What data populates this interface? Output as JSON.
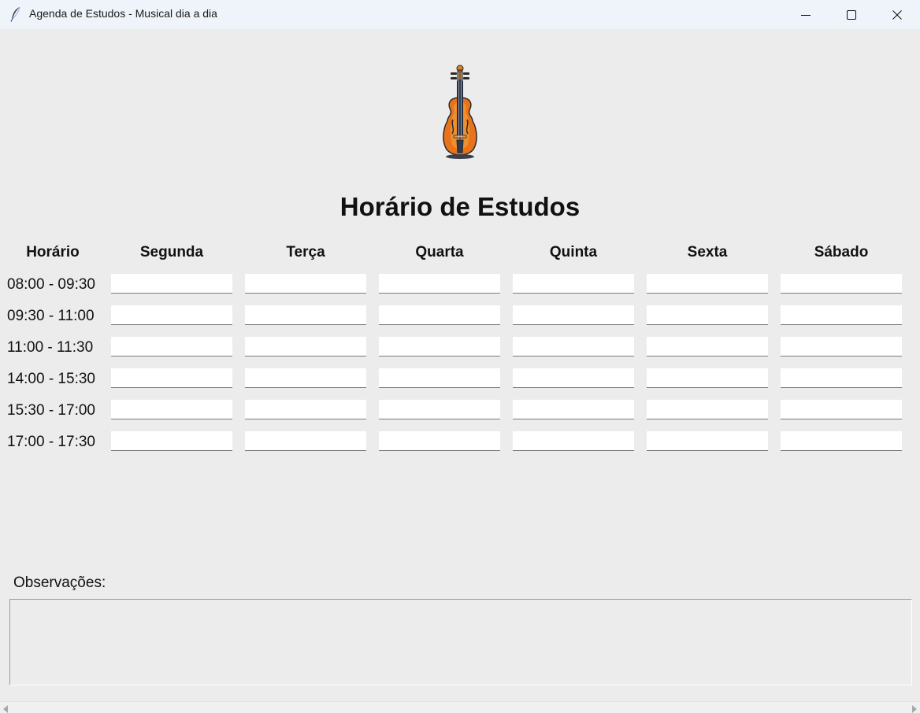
{
  "window": {
    "title": "Agenda de Estudos - Musical dia a dia",
    "app_icon": "feather-icon",
    "controls": [
      "minimize-icon",
      "maximize-icon",
      "close-icon"
    ]
  },
  "header": {
    "image": "violin-icon",
    "title": "Horário de Estudos"
  },
  "schedule": {
    "time_header": "Horário",
    "days": [
      "Segunda",
      "Terça",
      "Quarta",
      "Quinta",
      "Sexta",
      "Sábado"
    ],
    "times": [
      "08:00 - 09:30",
      "09:30 - 11:00",
      "11:00 - 11:30",
      "14:00 - 15:30",
      "15:30 - 17:00",
      "17:00 - 17:30"
    ],
    "cells": [
      [
        "",
        "",
        "",
        "",
        "",
        ""
      ],
      [
        "",
        "",
        "",
        "",
        "",
        ""
      ],
      [
        "",
        "",
        "",
        "",
        "",
        ""
      ],
      [
        "",
        "",
        "",
        "",
        "",
        ""
      ],
      [
        "",
        "",
        "",
        "",
        "",
        ""
      ],
      [
        "",
        "",
        "",
        "",
        "",
        ""
      ]
    ]
  },
  "notes": {
    "label": "Observações:",
    "value": ""
  },
  "colors": {
    "background": "#ececec",
    "titlebar": "#eff3fa",
    "entry": "#ffffff"
  }
}
